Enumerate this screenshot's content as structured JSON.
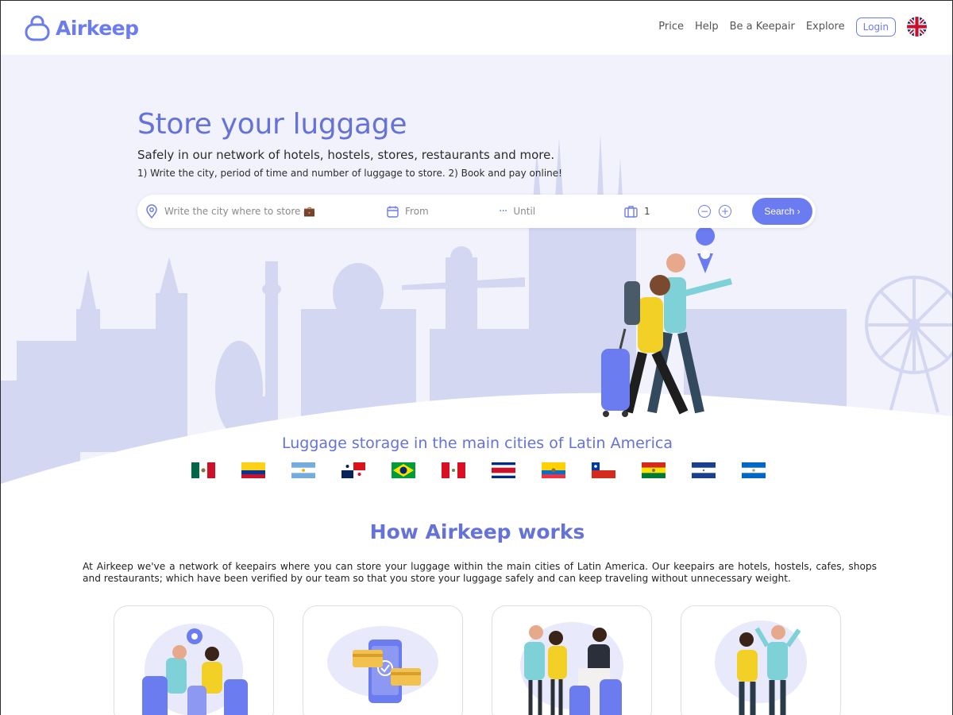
{
  "brand": {
    "name": "Airkeep",
    "accent": "#6b7cf0"
  },
  "nav": {
    "items": [
      "Price",
      "Help",
      "Be a Keepair",
      "Explore"
    ],
    "login_label": "Login",
    "language_icon": "uk-flag-icon"
  },
  "hero": {
    "title": "Store your luggage",
    "subtitle": "Safely in our network of hotels, hostels, stores, restaurants and more.",
    "steps": "1) Write the city, period of time and number of luggage to store. 2) Book and pay online!"
  },
  "search": {
    "city_placeholder": "Write the city where to store 💼",
    "from_placeholder": "From",
    "until_placeholder": "Until",
    "quantity": "1",
    "minus_icon": "minus-icon",
    "plus_icon": "plus-icon",
    "button_label": "Search ›"
  },
  "cities": {
    "title": "Luggage storage in the main cities of Latin America",
    "flags": [
      "mexico",
      "colombia",
      "argentina",
      "panama",
      "brazil",
      "peru",
      "costa-rica",
      "ecuador",
      "chile",
      "bolivia",
      "honduras",
      "nicaragua"
    ]
  },
  "how": {
    "title": "How Airkeep works",
    "text": "At Airkeep we've a network of keepairs where you can store your luggage within the main cities of Latin America. Our keepairs are hotels, hostels, cafes, shops and restaurants; which have been verified by our team so that you store your luggage safely and can keep traveling without unnecessary weight."
  }
}
